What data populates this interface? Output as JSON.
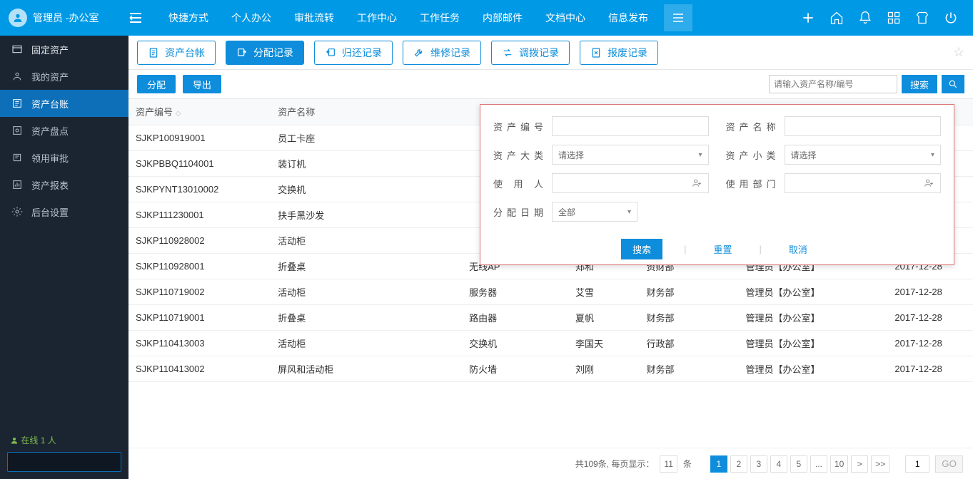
{
  "header": {
    "user_role": "管理员",
    "user_dept": "-办公室",
    "nav": [
      "快捷方式",
      "个人办公",
      "审批流转",
      "工作中心",
      "工作任务",
      "内部邮件",
      "文档中心",
      "信息发布"
    ]
  },
  "sidebar": {
    "items": [
      {
        "label": "固定资产",
        "level": 1
      },
      {
        "label": "我的资产",
        "level": 2
      },
      {
        "label": "资产台账",
        "level": 2,
        "selected": true
      },
      {
        "label": "资产盘点",
        "level": 2
      },
      {
        "label": "领用审批",
        "level": 2
      },
      {
        "label": "资产报表",
        "level": 2
      },
      {
        "label": "后台设置",
        "level": 2
      }
    ],
    "online_label": "在线",
    "online_count": "1 人"
  },
  "tabs": [
    {
      "label": "资产台帐"
    },
    {
      "label": "分配记录",
      "active": true
    },
    {
      "label": "归还记录"
    },
    {
      "label": "维修记录"
    },
    {
      "label": "调拨记录"
    },
    {
      "label": "报废记录"
    }
  ],
  "toolbar": {
    "btn_assign": "分配",
    "btn_export": "导出",
    "search_placeholder": "请输入资产名称/编号",
    "btn_search": "搜索"
  },
  "table": {
    "columns": [
      "资产编号",
      "资产名称",
      "",
      "",
      "",
      "",
      ""
    ],
    "col0": "资产编号",
    "col1": "资产名称",
    "rows": [
      {
        "id": "SJKP100919001",
        "name": "员工卡座",
        "sub": "",
        "user": "",
        "dept": "",
        "admin": "",
        "date": ""
      },
      {
        "id": "SJKPBBQ1104001",
        "name": "装订机",
        "sub": "",
        "user": "",
        "dept": "",
        "admin": "",
        "date": ""
      },
      {
        "id": "SJKPYNT13010002",
        "name": "交换机",
        "sub": "",
        "user": "",
        "dept": "",
        "admin": "",
        "date": ""
      },
      {
        "id": "SJKP111230001",
        "name": "扶手黑沙发",
        "sub": "",
        "user": "",
        "dept": "",
        "admin": "",
        "date": ""
      },
      {
        "id": "SJKP110928002",
        "name": "活动柜",
        "sub": "",
        "user": "",
        "dept": "",
        "admin": "",
        "date": ""
      },
      {
        "id": "SJKP110928001",
        "name": "折叠桌",
        "sub": "无线AP",
        "user": "郑和",
        "dept": "资财部",
        "admin": "管理员【办公室】",
        "date": "2017-12-28"
      },
      {
        "id": "SJKP110719002",
        "name": "活动柜",
        "sub": "服务器",
        "user": "艾雪",
        "dept": "财务部",
        "admin": "管理员【办公室】",
        "date": "2017-12-28"
      },
      {
        "id": "SJKP110719001",
        "name": "折叠桌",
        "sub": "路由器",
        "user": "夏帆",
        "dept": "财务部",
        "admin": "管理员【办公室】",
        "date": "2017-12-28"
      },
      {
        "id": "SJKP110413003",
        "name": "活动柜",
        "sub": "交换机",
        "user": "李国天",
        "dept": "行政部",
        "admin": "管理员【办公室】",
        "date": "2017-12-28"
      },
      {
        "id": "SJKP110413002",
        "name": "屏风和活动柜",
        "sub": "防火墙",
        "user": "刘刚",
        "dept": "财务部",
        "admin": "管理员【办公室】",
        "date": "2017-12-28"
      }
    ]
  },
  "popup": {
    "f_id": "资产编号",
    "f_name": "资产名称",
    "f_cat1": "资产大类",
    "f_cat2": "资产小类",
    "f_user": "使用人",
    "f_dept": "使用部门",
    "f_date": "分配日期",
    "ph_select": "请选择",
    "ph_all": "全部",
    "btn_search": "搜索",
    "btn_reset": "重置",
    "btn_cancel": "取消"
  },
  "pager": {
    "total_prefix": "共",
    "total": "109",
    "total_suffix": "条, 每页显示：",
    "per_page": "11",
    "per_page_suffix": "条",
    "pages": [
      "1",
      "2",
      "3",
      "4",
      "5",
      "...",
      "10",
      ">",
      ">>"
    ],
    "goto": "1",
    "go": "GO"
  }
}
